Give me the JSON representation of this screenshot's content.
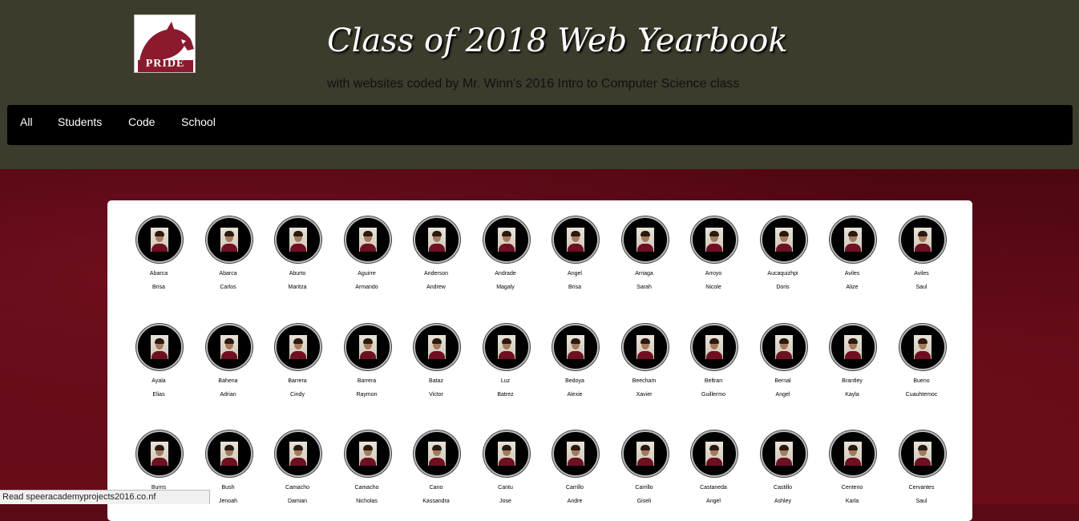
{
  "header": {
    "logo_text": "PRIDE",
    "title": "Class of 2018 Web Yearbook",
    "subtitle": "with websites coded by Mr. Winn's 2016 Intro to Computer Science class"
  },
  "nav": {
    "items": [
      {
        "label": "All"
      },
      {
        "label": "Students"
      },
      {
        "label": "Code"
      },
      {
        "label": "School"
      }
    ]
  },
  "students": [
    {
      "last": "Abarca",
      "first": "Brisa"
    },
    {
      "last": "Abarca",
      "first": "Carlos"
    },
    {
      "last": "Aburto",
      "first": "Maritza"
    },
    {
      "last": "Aguirre",
      "first": "Armando"
    },
    {
      "last": "Anderson",
      "first": "Andrew"
    },
    {
      "last": "Andrade",
      "first": "Magaly"
    },
    {
      "last": "Angel",
      "first": "Brisa"
    },
    {
      "last": "Arriaga",
      "first": "Sarah"
    },
    {
      "last": "Arroyo",
      "first": "Nicole"
    },
    {
      "last": "Aucaquizhpi",
      "first": "Doris"
    },
    {
      "last": "Aviles",
      "first": "Alize"
    },
    {
      "last": "Aviles",
      "first": "Saul"
    },
    {
      "last": "Ayala",
      "first": "Elias"
    },
    {
      "last": "Bahena",
      "first": "Adrian"
    },
    {
      "last": "Barrera",
      "first": "Cindy"
    },
    {
      "last": "Barrera",
      "first": "Raymon"
    },
    {
      "last": "Bataz",
      "first": "Victor"
    },
    {
      "last": "Luz",
      "first": "Batrez"
    },
    {
      "last": "Bedoya",
      "first": "Alexie"
    },
    {
      "last": "Beecham",
      "first": "Xavier"
    },
    {
      "last": "Beltran",
      "first": "Guillermo"
    },
    {
      "last": "Bernal",
      "first": "Angel"
    },
    {
      "last": "Brantley",
      "first": "Kayla"
    },
    {
      "last": "Bueno",
      "first": "Cuauhtemoc"
    },
    {
      "last": "Burns",
      "first": ""
    },
    {
      "last": "Bush",
      "first": "Jenoah"
    },
    {
      "last": "Camacho",
      "first": "Damian"
    },
    {
      "last": "Camacho",
      "first": "Nicholas"
    },
    {
      "last": "Cano",
      "first": "Kassandra"
    },
    {
      "last": "Cantu",
      "first": "Jose"
    },
    {
      "last": "Carrillo",
      "first": "Andre"
    },
    {
      "last": "Carrillo",
      "first": "Giseli"
    },
    {
      "last": "Castaneda",
      "first": "Angel"
    },
    {
      "last": "Castillo",
      "first": "Ashley"
    },
    {
      "last": "Centeno",
      "first": "Karla"
    },
    {
      "last": "Cervantes",
      "first": "Saul"
    }
  ],
  "status_bar": {
    "text": "Read speeracademyprojects2016.co.nf"
  },
  "colors": {
    "header_bg": "#3c3b2c",
    "navbar_bg": "#000000",
    "page_bg": "#5a0a14",
    "brand": "#8b1a2e"
  }
}
